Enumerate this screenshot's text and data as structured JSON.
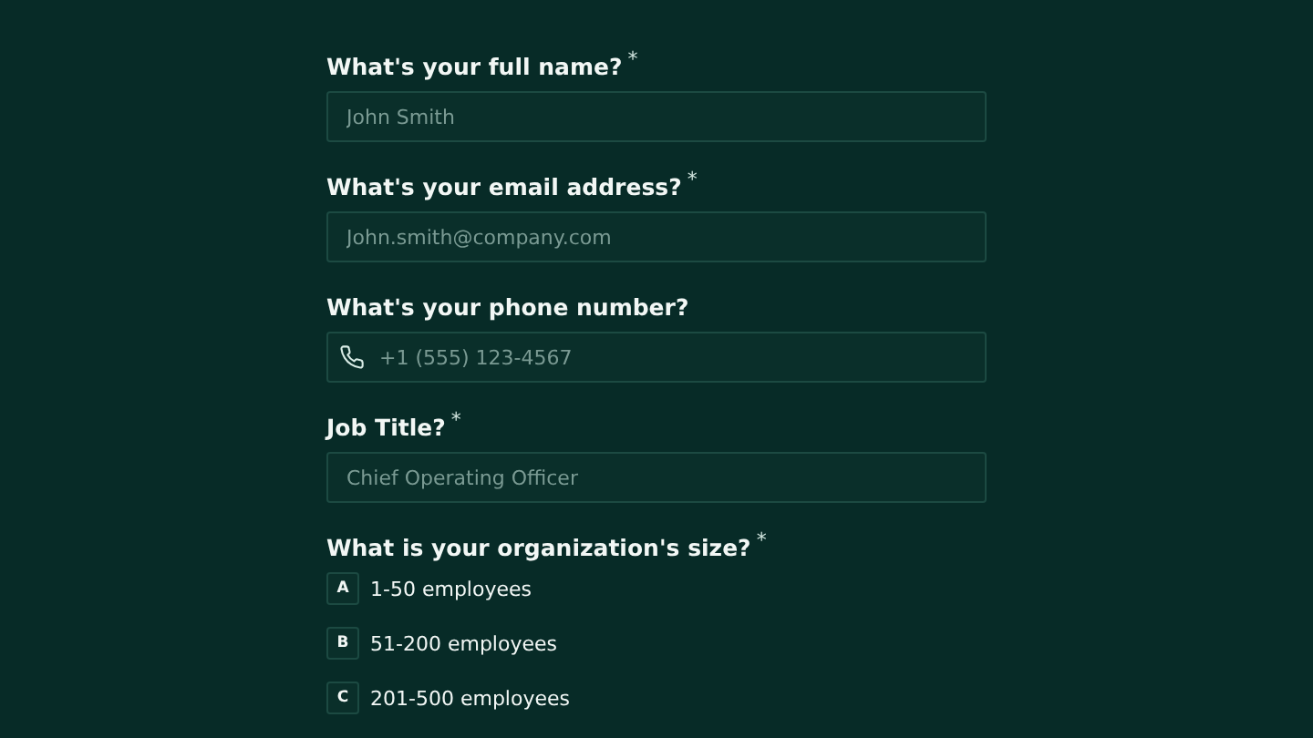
{
  "questions": [
    {
      "kind": "text",
      "label": "What's your full name?",
      "required_mark": "*",
      "placeholder": "John Smith"
    },
    {
      "kind": "text",
      "label": "What's your email address?",
      "required_mark": "*",
      "placeholder": "John.smith@company.com"
    },
    {
      "kind": "phone",
      "label": "What's your phone number?",
      "placeholder": "+1 (555) 123-4567"
    },
    {
      "kind": "text",
      "label": "Job Title?",
      "required_mark": "*",
      "placeholder": "Chief Operating Officer"
    },
    {
      "kind": "choice",
      "label": "What is your organization's size?",
      "required_mark": "*",
      "options": [
        {
          "key": "A",
          "label": "1-50 employees",
          "selected": false
        },
        {
          "key": "B",
          "label": "51-200 employees",
          "selected": false
        },
        {
          "key": "C",
          "label": "201-500 employees",
          "selected": false
        }
      ]
    }
  ]
}
